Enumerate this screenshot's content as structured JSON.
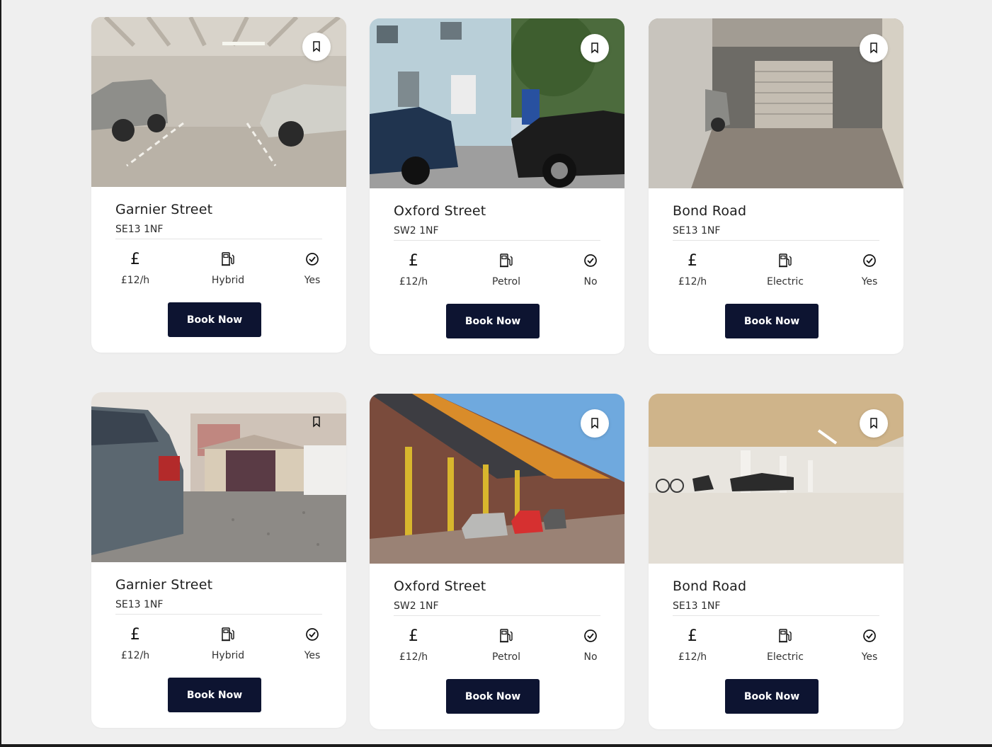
{
  "cards": [
    {
      "title": "Garnier Street",
      "postcode": "SE13 1NF",
      "price": "£12/h",
      "fuel": "Hybrid",
      "available": "Yes",
      "book_label": "Book Now",
      "photo": "underground-parking-two-cars"
    },
    {
      "title": "Oxford Street",
      "postcode": "SW2 1NF",
      "price": "£12/h",
      "fuel": "Petrol",
      "available": "No",
      "book_label": "Book Now",
      "photo": "street-parking-houses"
    },
    {
      "title": "Bond Road",
      "postcode": "SE13 1NF",
      "price": "£12/h",
      "fuel": "Electric",
      "available": "Yes",
      "book_label": "Book Now",
      "photo": "garage-entrance"
    },
    {
      "title": "Garnier Street",
      "postcode": "SE13 1NF",
      "price": "£12/h",
      "fuel": "Hybrid",
      "available": "Yes",
      "book_label": "Book Now",
      "photo": "car-by-garage-gravel"
    },
    {
      "title": "Oxford Street",
      "postcode": "SW2 1NF",
      "price": "£12/h",
      "fuel": "Petrol",
      "available": "No",
      "book_label": "Book Now",
      "photo": "row-houses-parked-cars"
    },
    {
      "title": "Bond Road",
      "postcode": "SE13 1NF",
      "price": "£12/h",
      "fuel": "Electric",
      "available": "Yes",
      "book_label": "Book Now",
      "photo": "underground-car-park"
    }
  ],
  "icons": {
    "bookmark": "bookmark-icon",
    "price": "pound-icon",
    "fuel": "fuel-pump-icon",
    "available": "check-circle-icon"
  },
  "colors": {
    "button_bg": "#0d1431",
    "button_text": "#ffffff",
    "page_bg": "#efefef"
  }
}
